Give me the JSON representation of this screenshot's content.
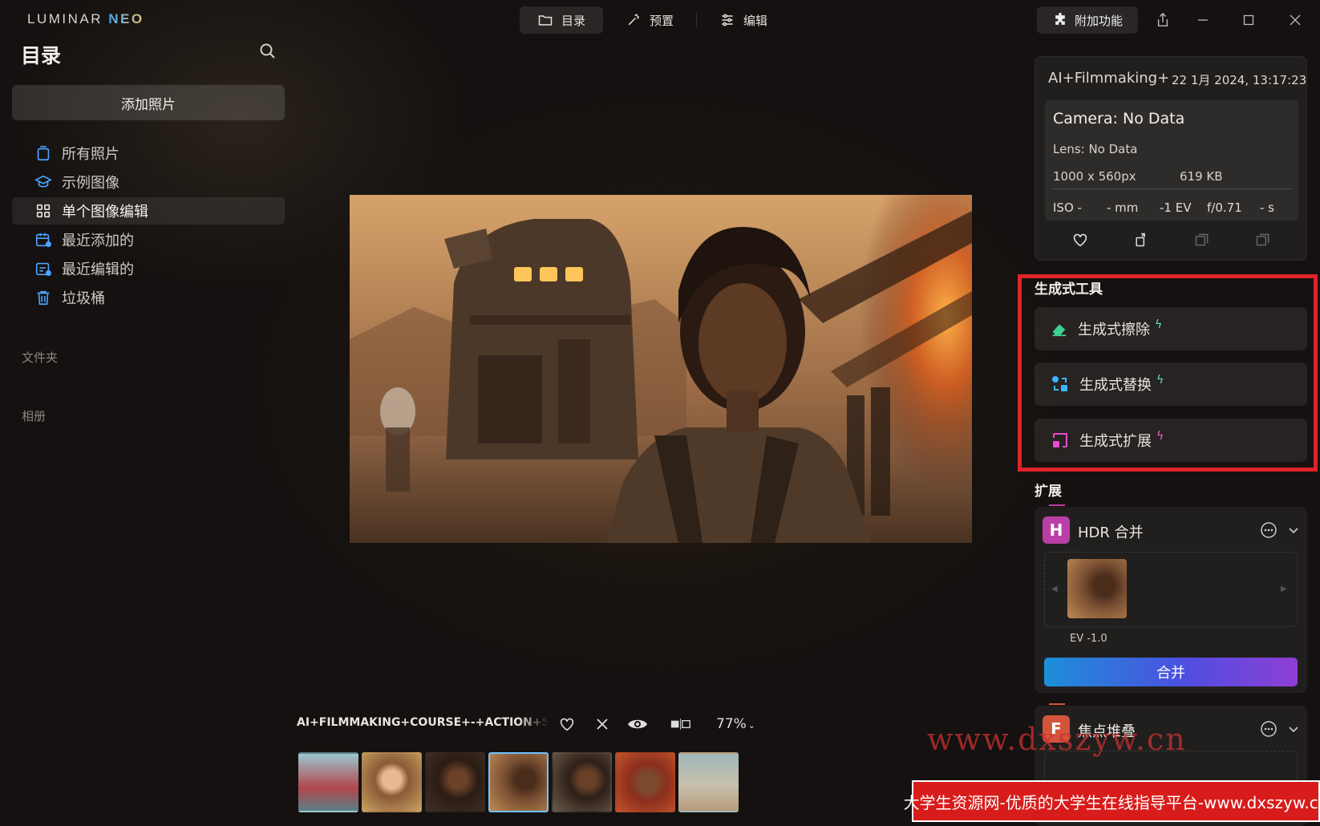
{
  "app": {
    "logo_main": "LUMINAR ",
    "logo_neo": "NEO"
  },
  "nav": {
    "tabs": [
      {
        "label": "目录",
        "icon": "folder-icon",
        "active": true
      },
      {
        "label": "预置",
        "icon": "magic-wand-icon",
        "active": false
      },
      {
        "label": "编辑",
        "icon": "sliders-icon",
        "active": false
      }
    ],
    "addon_label": "附加功能"
  },
  "sidebar": {
    "title": "目录",
    "add_photos": "添加照片",
    "items": [
      {
        "label": "所有照片",
        "icon": "photos-stack-icon"
      },
      {
        "label": "示例图像",
        "icon": "graduation-cap-icon"
      },
      {
        "label": "单个图像编辑",
        "icon": "grid-icon",
        "active": true
      },
      {
        "label": "最近添加的",
        "icon": "calendar-added-icon"
      },
      {
        "label": "最近编辑的",
        "icon": "calendar-edited-icon"
      },
      {
        "label": "垃圾桶",
        "icon": "trash-icon"
      }
    ],
    "folders_label": "文件夹",
    "albums_label": "相册"
  },
  "bottom_bar": {
    "file_name": "AI+FILMMAKING+COURSE+-+ACTION+S",
    "zoom": "77%"
  },
  "info": {
    "file": "AI+Filmmaking+C",
    "date": "22 1月 2024, 13:17:23",
    "camera": "Camera: No Data",
    "lens": "Lens: No Data",
    "dimensions": "1000 x 560px",
    "size": "619 KB",
    "iso": "ISO -",
    "focal": "- mm",
    "ev": "-1 EV",
    "aperture": "f/0.71",
    "shutter": "- s"
  },
  "generative": {
    "title": "生成式工具",
    "tools": [
      {
        "label": "生成式擦除",
        "icon": "eraser-icon"
      },
      {
        "label": "生成式替换",
        "icon": "replace-icon"
      },
      {
        "label": "生成式扩展",
        "icon": "expand-icon"
      }
    ]
  },
  "extensions": {
    "title": "扩展",
    "hdr": {
      "badge": "H",
      "name": "HDR 合并",
      "ev_label": "EV -1.0",
      "merge": "合并",
      "badge_color": "#b93fa6"
    },
    "focus": {
      "badge": "F",
      "name": "焦点堆叠",
      "badge_color": "#d4533b"
    }
  },
  "watermark": {
    "url": "www.dxszyw.cn",
    "banner": "大学生资源网-优质的大学生在线指导平台-www.dxszyw.cn"
  },
  "colors": {
    "accent_blue": "#6fc3ff",
    "highlight_red": "#e0232b",
    "bolt_teal": "#5ee1c2"
  }
}
